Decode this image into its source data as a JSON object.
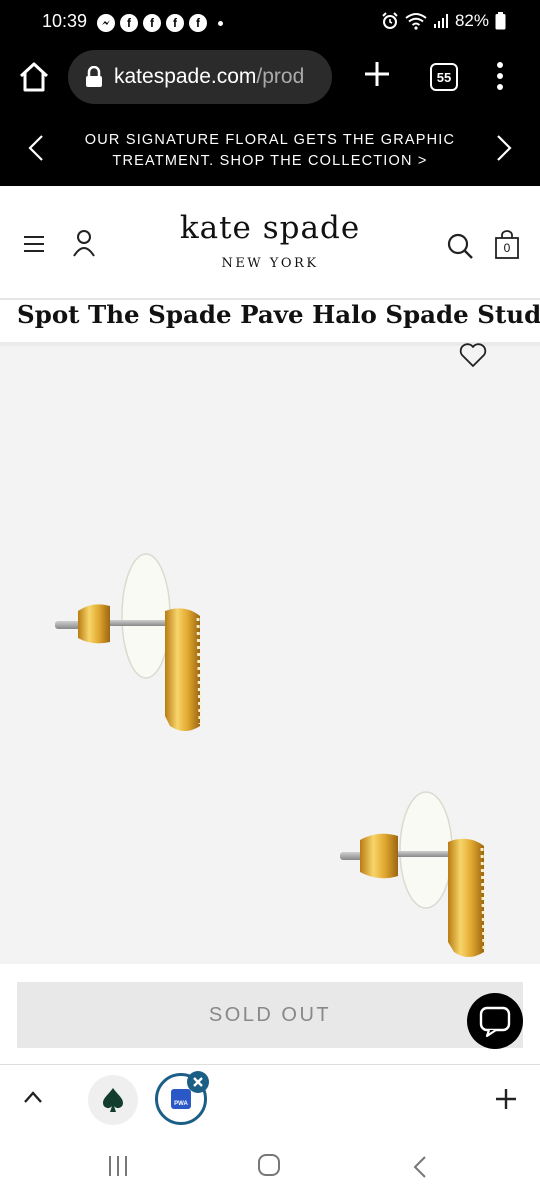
{
  "status_bar": {
    "time": "10:39",
    "notification_icons": [
      "messenger-icon",
      "facebook-icon",
      "facebook-icon",
      "facebook-icon",
      "facebook-icon"
    ],
    "battery": "82%"
  },
  "browser": {
    "url_main": "katespade.com",
    "url_rest": "/prod",
    "tab_count": "55"
  },
  "promo": {
    "text": "OUR SIGNATURE FLORAL GETS THE GRAPHIC TREATMENT. SHOP THE COLLECTION >"
  },
  "header": {
    "logo_main": "kate spade",
    "logo_sub": "NEW YORK",
    "bag_count": "0"
  },
  "product": {
    "title": "Spot The Spade Pave Halo Spade Studs",
    "cta_label": "SOLD OUT"
  },
  "toolbar": {
    "pwa_label": "PWA"
  },
  "colors": {
    "gold": "#e0a92e",
    "pwa_ring": "#1c5f86",
    "cta_bg": "#e8e8e8"
  }
}
